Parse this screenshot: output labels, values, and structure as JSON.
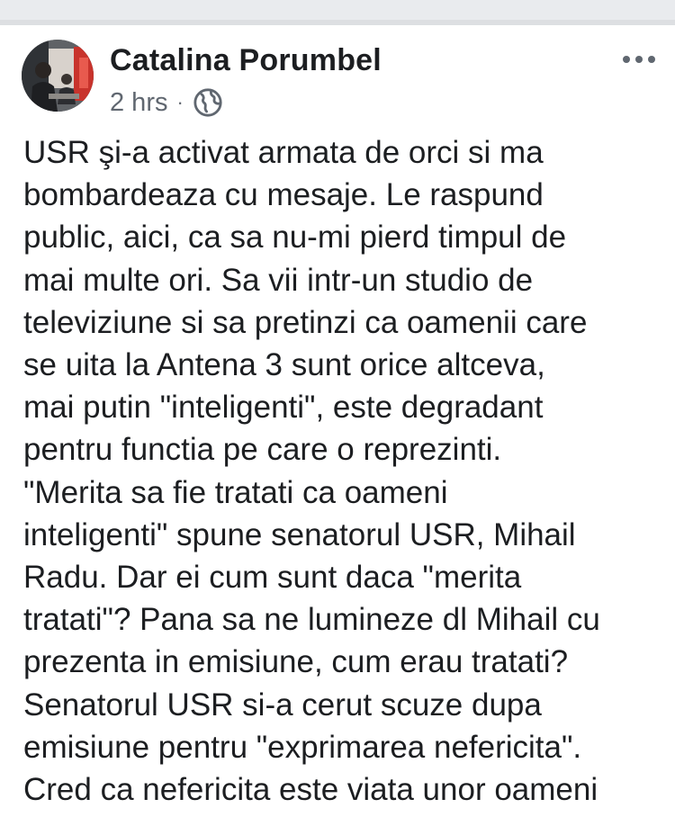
{
  "post": {
    "author": "Catalina Porumbel",
    "timestamp": "2 hrs",
    "separator": "·",
    "privacy_icon": "globe-icon",
    "more_icon": "more-options-icon",
    "body_lines": [
      "USR şi-a activat armata de orci si ma",
      "bombardeaza cu mesaje. Le raspund",
      "public, aici, ca sa nu-mi pierd timpul de",
      "mai multe ori. Sa vii intr-un studio de",
      "televiziune si sa pretinzi ca oamenii care",
      "se uita la Antena 3 sunt orice altceva,",
      "mai putin \"inteligenti\",  este degradant",
      "pentru functia pe care o reprezinti.",
      "\"Merita sa fie tratati ca oameni",
      "inteligenti\" spune senatorul USR, Mihail",
      "Radu. Dar ei cum sunt daca \"merita",
      "tratati\"? Pana sa ne lumineze dl Mihail cu",
      "prezenta in emisiune, cum erau tratati?",
      "Senatorul USR si-a cerut scuze dupa",
      "emisiune pentru \"exprimarea nefericita\".",
      "Cred ca nefericita este viata unor oameni"
    ]
  }
}
